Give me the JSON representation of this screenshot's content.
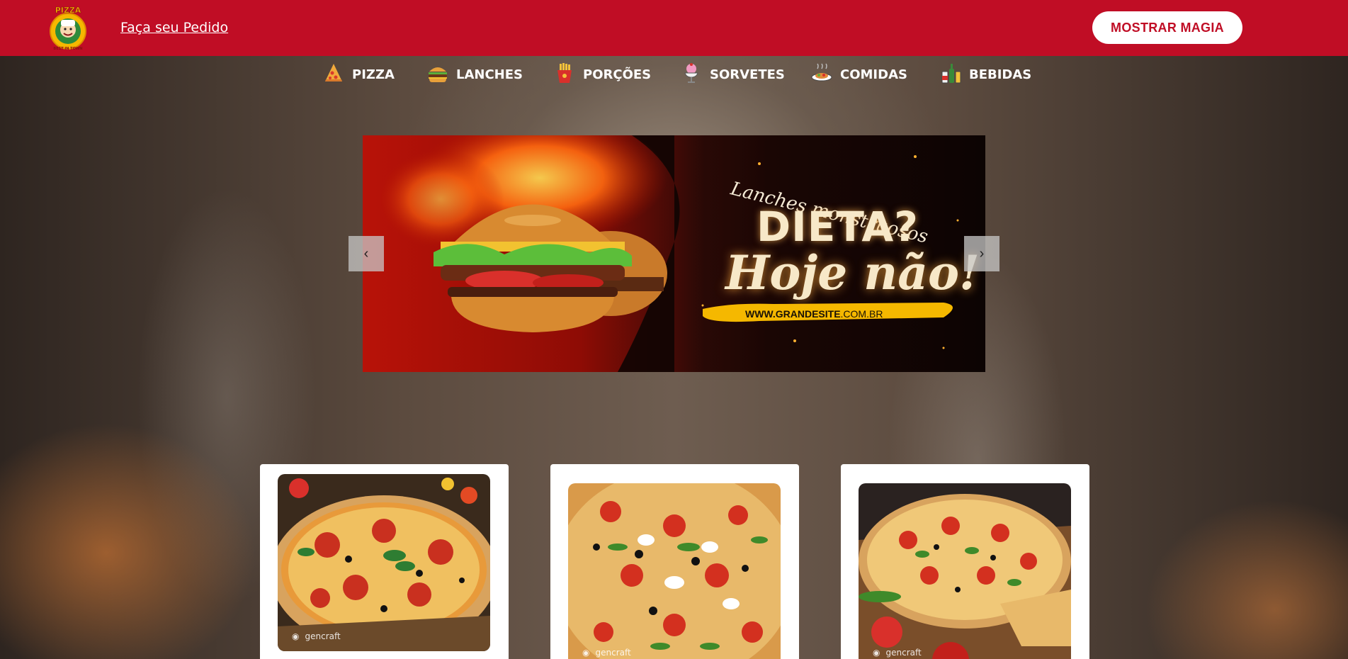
{
  "header": {
    "order_link": "Faça seu Pedido",
    "magic_button": "MOSTRAR MAGIA",
    "logo_text_top": "PIZZA",
    "logo_text_bottom": "BEST IN TOWN"
  },
  "nav": {
    "items": [
      {
        "label": "PIZZA",
        "icon": "pizza-slice-icon"
      },
      {
        "label": "LANCHES",
        "icon": "burger-icon"
      },
      {
        "label": "PORÇÕES",
        "icon": "fries-icon"
      },
      {
        "label": "SORVETES",
        "icon": "ice-cream-icon"
      },
      {
        "label": "COMIDAS",
        "icon": "food-dish-icon"
      },
      {
        "label": "BEBIDAS",
        "icon": "drinks-icon"
      }
    ]
  },
  "carousel": {
    "script_line": "Lanches monstruosos",
    "headline": "DIETA?",
    "tagline": "Hoje não!",
    "url_bold": "WWW.GRANDESITE",
    "url_rest": ".COM.BR",
    "prev": "‹",
    "next": "›"
  },
  "cards": [
    {
      "watermark": "gencraft"
    },
    {
      "watermark": "gencraft"
    },
    {
      "watermark": "gencraft"
    }
  ],
  "colors": {
    "brand_red": "#c00d25",
    "banner_yellow": "#f5b800"
  }
}
